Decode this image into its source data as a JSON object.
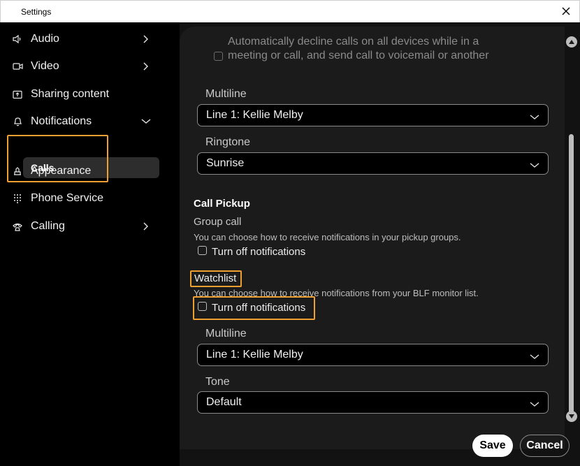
{
  "window": {
    "title": "Settings"
  },
  "sidebar": {
    "items": [
      {
        "label": "Audio",
        "icon": "speaker-icon"
      },
      {
        "label": "Video",
        "icon": "video-icon"
      },
      {
        "label": "Sharing content",
        "icon": "share-screen-icon"
      },
      {
        "label": "Notifications",
        "icon": "bell-icon"
      },
      {
        "label": "Appearance",
        "icon": "appearance-icon"
      },
      {
        "label": "Phone Service",
        "icon": "dialpad-icon"
      },
      {
        "label": "Calling",
        "icon": "phone-icon"
      }
    ],
    "sub_item": "Calls"
  },
  "content": {
    "auto_decline_line1": "Automatically decline calls on all devices while in a",
    "auto_decline_line2": "meeting or call, and send call to voicemail or another",
    "multiline_label": "Multiline",
    "multiline_value": "Line 1: Kellie Melby",
    "ringtone_label": "Ringtone",
    "ringtone_value": "Sunrise",
    "call_pickup_heading": "Call Pickup",
    "group_call_label": "Group call",
    "group_call_desc": "You can choose how to receive notifications in your pickup groups.",
    "group_call_checkbox": "Turn off notifications",
    "watchlist_label": "Watchlist",
    "watchlist_desc": "You can choose how to receive notifications from your BLF monitor list.",
    "watchlist_checkbox": "Turn off notifications",
    "watch_multiline_label": "Multiline",
    "watch_multiline_value": "Line 1: Kellie Melby",
    "tone_label": "Tone",
    "tone_value": "Default"
  },
  "footer": {
    "save": "Save",
    "cancel": "Cancel"
  },
  "colors": {
    "highlight": "#f0a030",
    "sidebar_bg": "#000000",
    "panel_bg": "#1b1b1b"
  }
}
